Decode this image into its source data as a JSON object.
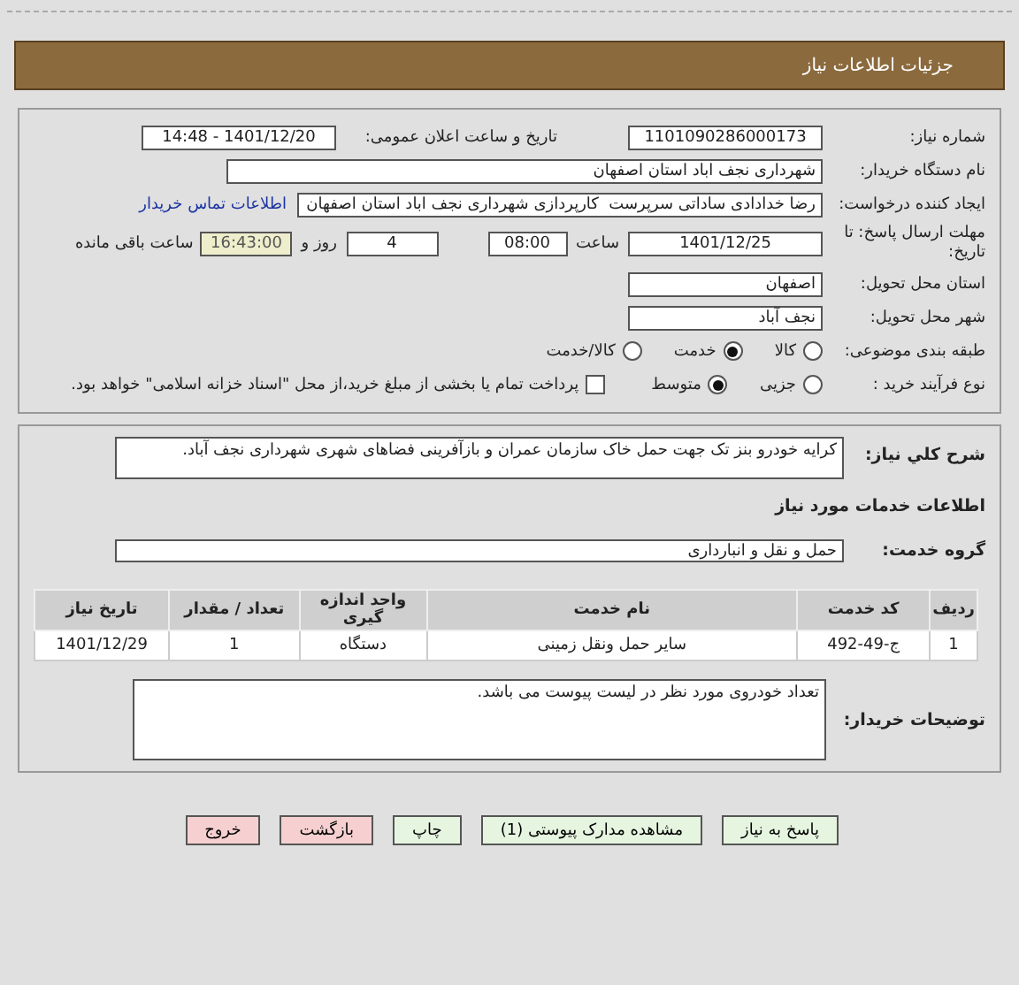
{
  "header": {
    "title": "جزئیات اطلاعات نیاز"
  },
  "need_number": {
    "label": "شماره نیاز:",
    "value": "1101090286000173"
  },
  "announce": {
    "label": "تاریخ و ساعت اعلان عمومی:",
    "value": "1401/12/20 - 14:48"
  },
  "buyer_org": {
    "label": "نام دستگاه خریدار:",
    "value": "شهرداری نجف اباد استان اصفهان"
  },
  "requester": {
    "label": "ایجاد کننده درخواست:",
    "value": "رضا خدادادی ساداتی سرپرست  کارپردازی شهرداری نجف اباد استان اصفهان",
    "link": "اطلاعات تماس خریدار"
  },
  "deadline": {
    "label": "مهلت ارسال پاسخ: تا تاریخ:",
    "date": "1401/12/25",
    "time_label": "ساعت",
    "time": "08:00",
    "days": "4",
    "days_label": "روز و",
    "remaining": "16:43:00",
    "remaining_label": "ساعت باقی مانده"
  },
  "province": {
    "label": "استان محل تحویل:",
    "value": "اصفهان"
  },
  "city": {
    "label": "شهر محل تحویل:",
    "value": "نجف آباد"
  },
  "category": {
    "label": "طبقه بندی موضوعی:",
    "options": [
      {
        "label": "کالا",
        "selected": false
      },
      {
        "label": "خدمت",
        "selected": true
      },
      {
        "label": "کالا/خدمت",
        "selected": false
      }
    ]
  },
  "process": {
    "label": "نوع فرآیند خرید :",
    "options": [
      {
        "label": "جزیی",
        "selected": false
      },
      {
        "label": "متوسط",
        "selected": true
      }
    ],
    "treasury": {
      "label": "پرداخت تمام یا بخشی از مبلغ خرید،از محل \"اسناد خزانه اسلامی\" خواهد بود.",
      "checked": false
    }
  },
  "description": {
    "label": "شرح کلي نياز:",
    "value": "کرایه خودرو بنز تک جهت حمل خاک سازمان عمران و بازآفرینی فضاهای شهری شهرداری نجف آباد."
  },
  "services_title": "اطلاعات خدمات مورد نیاز",
  "service_group": {
    "label": "گروه خدمت:",
    "value": "حمل و نقل و انبارداری"
  },
  "table": {
    "columns": [
      "ردیف",
      "کد خدمت",
      "نام خدمت",
      "واحد اندازه گیری",
      "تعداد / مقدار",
      "تاریخ نیاز"
    ],
    "rows": [
      [
        "1",
        "ج-49-492",
        "سایر حمل ونقل زمینی",
        "دستگاه",
        "1",
        "1401/12/29"
      ]
    ]
  },
  "buyer_notes": {
    "label": "توضیحات خریدار:",
    "value": "تعداد خودروی مورد نظر در لیست پیوست می باشد."
  },
  "buttons": [
    {
      "label": "پاسخ به نیاز",
      "kind": "action"
    },
    {
      "label": "مشاهده مدارک پیوستی (1)",
      "kind": "action"
    },
    {
      "label": "چاپ",
      "kind": "action"
    },
    {
      "label": "بازگشت",
      "kind": "exit"
    },
    {
      "label": "خروج",
      "kind": "exit"
    }
  ]
}
